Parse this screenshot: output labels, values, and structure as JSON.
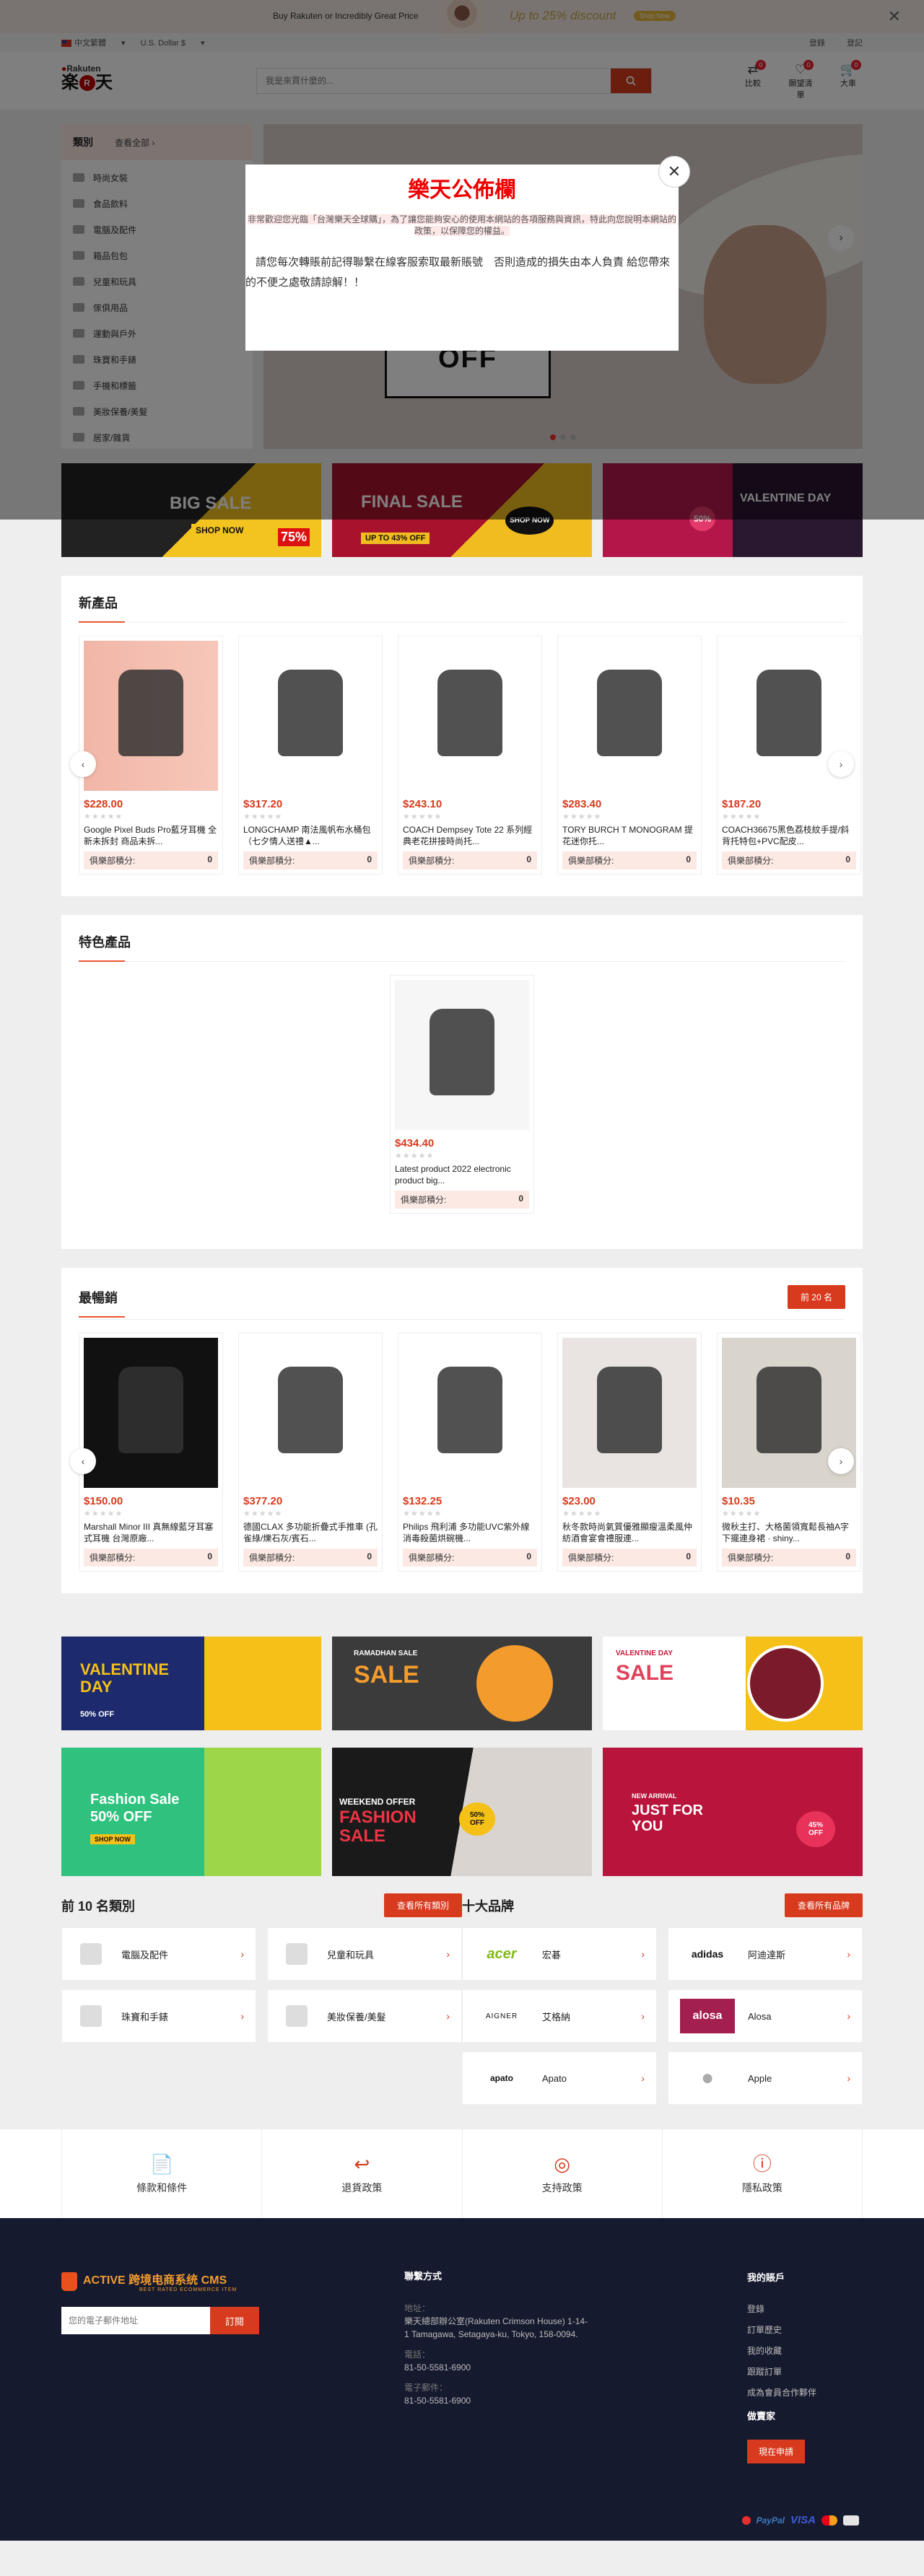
{
  "promo_bar": {
    "text_left": "Buy Rakuten or Incredibly Great Price",
    "text_right": "Up to 25% discount",
    "cta": "Shop Now",
    "close": "✕"
  },
  "topbar": {
    "language": "中文繁體",
    "currency": "U.S. Dollar $",
    "login": "登錄",
    "register": "登記"
  },
  "header": {
    "logo_top": "Rakuten",
    "logo_main": "樂天",
    "search_placeholder": "我是來買什麼的...",
    "compare": {
      "label": "比較",
      "count": "0"
    },
    "wishlist": {
      "label": "願望清單",
      "count": "0"
    },
    "cart": {
      "label": "大車",
      "count": "0"
    }
  },
  "categories": {
    "title": "類別",
    "all": "查看全部 ›",
    "items": [
      "時尚女裝",
      "食品飲料",
      "電腦及配件",
      "箱品包包",
      "兒童和玩具",
      "傢俱用品",
      "運動與戶外",
      "珠寶和手錶",
      "手機和標籤",
      "美妝保養/美髮",
      "居家/雜貨"
    ]
  },
  "hero": {
    "off": "OFF",
    "next": "›"
  },
  "banners_top": [
    {
      "title": "BIG SALE",
      "sub": "SHOP NOW",
      "badge": "75%"
    },
    {
      "title": "FINAL SALE",
      "sub": "UP TO 43% OFF",
      "cta": "SHOP NOW"
    },
    {
      "title": "VALENTINE DAY",
      "badge": "50%"
    }
  ],
  "modal": {
    "title": "樂天公佈欄",
    "highlight": "非常歡迎您光臨「台灣樂天全球購」，為了讓您能夠安心的使用本網站的各項服務與資訊，特此向您說明本網站的政策，以保障您的權益。",
    "body": "請您每次轉賬前記得聯繫在線客服索取最新賬號　否則造成的損失由本人負責 給您帶來的不便之處敬請諒解！！",
    "close": "✕"
  },
  "new_products": {
    "title": "新產品",
    "items": [
      {
        "price": "$228.00",
        "name": "Google Pixel Buds Pro藍牙耳機 全新未拆封 商品未拆...",
        "club_label": "俱樂部積分:",
        "points": "0",
        "img": "buds"
      },
      {
        "price": "$317.20",
        "name": "LONGCHAMP 南法風帆布水桶包（七夕情人送禮▲...",
        "club_label": "俱樂部積分:",
        "points": "0",
        "img": "bucket"
      },
      {
        "price": "$243.10",
        "name": "COACH Dempsey Tote 22 系列經典老花拼接時尚托...",
        "club_label": "俱樂部積分:",
        "points": "0",
        "img": "tote"
      },
      {
        "price": "$283.40",
        "name": "TORY BURCH T MONOGRAM 提花迷你托...",
        "club_label": "俱樂部積分:",
        "points": "0",
        "img": "mini"
      },
      {
        "price": "$187.20",
        "name": "COACH36675黑色荔枝紋手提/斜背托特包+PVC配皮...",
        "club_label": "俱樂部積分:",
        "points": "0",
        "img": "black"
      }
    ]
  },
  "featured": {
    "title": "特色產品",
    "items": [
      {
        "price": "$434.40",
        "name": "Latest product 2022 electronic product big...",
        "club_label": "俱樂部積分:",
        "points": "0"
      }
    ]
  },
  "bestsellers": {
    "title": "最暢銷",
    "button": "前 20 名",
    "items": [
      {
        "price": "$150.00",
        "name": "Marshall Minor III 真無線藍牙耳塞式耳機 台灣原廠...",
        "club_label": "俱樂部積分:",
        "points": "0",
        "brand": "Marshall"
      },
      {
        "price": "$377.20",
        "name": "德國CLAX 多功能折疊式手推車 (孔雀綠/爍石灰/賓石...",
        "club_label": "俱樂部積分:",
        "points": "0",
        "brand": "CLAX"
      },
      {
        "price": "$132.25",
        "name": "Philips 飛利浦 多功能UVC紫外線消毒殺菌烘碗機...",
        "club_label": "俱樂部積分:",
        "points": "0"
      },
      {
        "price": "$23.00",
        "name": "秋冬款時尚氣質優雅顯瘦溫柔風仲紡酒會宴會禮服連...",
        "club_label": "俱樂部積分:",
        "points": "0"
      },
      {
        "price": "$10.35",
        "name": "微秋主打、大格菌領寬鬆長袖A字下擺連身裙 · shiny...",
        "club_label": "俱樂部積分:",
        "points": "0"
      }
    ]
  },
  "promo_grid": [
    {
      "title": "VALENTINE DAY",
      "small": "50% OFF"
    },
    {
      "title": "SALE",
      "small": "RAMADHAN SALE"
    },
    {
      "title": "SALE",
      "small": "VALENTINE DAY"
    },
    {
      "title": "Fashion Sale 50% OFF",
      "small": "SHOP NOW"
    },
    {
      "title": "FASHION SALE",
      "small": "WEEKEND OFFER",
      "badge": "50% OFF"
    },
    {
      "title": "JUST FOR YOU",
      "small": "NEW ARRIVAL",
      "badge": "45% OFF"
    }
  ],
  "top_categories": {
    "title": "前 10 名類別",
    "button": "查看所有類別",
    "items": [
      "電腦及配件",
      "兒童和玩具",
      "珠寶和手錶",
      "美妝保養/美髮"
    ]
  },
  "top_brands": {
    "title": "十大品牌",
    "button": "查看所有品牌",
    "items": [
      {
        "name": "宏碁",
        "logo": "acer"
      },
      {
        "name": "阿迪達斯",
        "logo": "adidas"
      },
      {
        "name": "艾格納",
        "logo": "AIGNER"
      },
      {
        "name": "Alosa",
        "logo": "alosa"
      },
      {
        "name": "Apato",
        "logo": "apato"
      },
      {
        "name": "Apple",
        "logo": ""
      }
    ]
  },
  "policies": [
    "條款和條件",
    "退貨政策",
    "支持政策",
    "隱私政策"
  ],
  "footer": {
    "brand": "ACTIVE 跨境电商系统 CMS",
    "brand_sub": "BEST RATED ECOMMERCE ITEM",
    "email_placeholder": "您的電子郵件地址",
    "subscribe": "訂閱",
    "contact_title": "聯繫方式",
    "address_label": "地址：",
    "address": "樂天總部辦公室(Rakuten Crimson House) 1-14-1 Tamagawa, Setagaya-ku, Tokyo, 158-0094.",
    "phone_label": "電話：",
    "phone": "81-50-5581-6900",
    "email_label": "電子郵件：",
    "email": "81-50-5581-6900",
    "account_title": "我的賬戶",
    "account_links": [
      "登錄",
      "訂單歷史",
      "我的收藏",
      "跟蹤訂單",
      "成為會員合作夥伴"
    ],
    "seller_title": "做賣家",
    "seller_button": "現在申請",
    "payments": [
      "PayPal",
      "VISA"
    ]
  }
}
